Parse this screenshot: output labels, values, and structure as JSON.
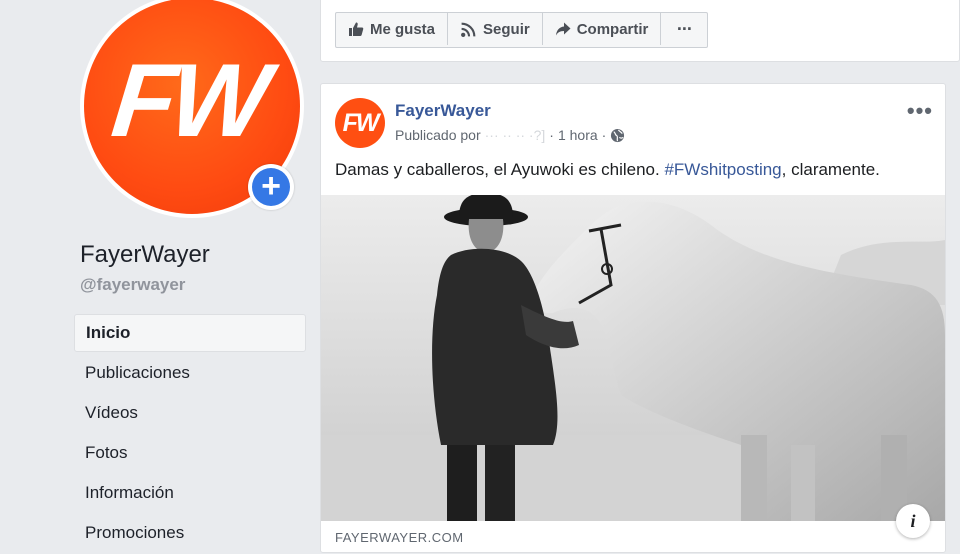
{
  "page": {
    "logo_text": "FW",
    "name": "FayerWayer",
    "handle": "@fayerwayer",
    "add_photo_symbol": "+"
  },
  "nav": {
    "items": [
      {
        "label": "Inicio",
        "active": true
      },
      {
        "label": "Publicaciones",
        "active": false
      },
      {
        "label": "Vídeos",
        "active": false
      },
      {
        "label": "Fotos",
        "active": false
      },
      {
        "label": "Información",
        "active": false
      },
      {
        "label": "Promociones",
        "active": false
      }
    ]
  },
  "actions": {
    "like": {
      "label": "Me gusta",
      "icon": "thumbs-up-icon"
    },
    "follow": {
      "label": "Seguir",
      "icon": "rss-icon"
    },
    "share": {
      "label": "Compartir",
      "icon": "share-arrow-icon"
    },
    "more": {
      "label": "···",
      "icon": "more-icon"
    }
  },
  "post": {
    "avatar_text": "FW",
    "author": "FayerWayer",
    "published_by": "Publicado por",
    "redacted_name": "··· ·· ·· ·?]",
    "separator": "·",
    "time": "1 hora",
    "audience_icon": "globe-icon",
    "more": "•••",
    "text_before": "Damas y caballeros, el Ayuwoki es chileno. ",
    "hashtag": "#FWshitposting",
    "text_after": ", claramente.",
    "link_domain": "FAYERWAYER.COM",
    "info_symbol": "i"
  },
  "colors": {
    "brand_orange": "#ff4f12",
    "facebook_blue": "#385898",
    "accent_blue": "#3578e5",
    "background": "#e9ebee"
  }
}
